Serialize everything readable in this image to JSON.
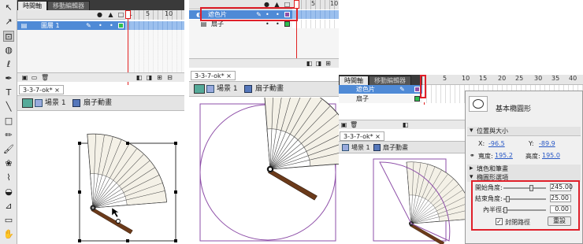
{
  "panel1": {
    "tabs": [
      "時間軸",
      "移動編輯器"
    ],
    "ruler": [
      "1",
      "5",
      "10"
    ],
    "layer": "圖層 1",
    "doc_tab": "3-3-7-ok*",
    "scene": "場景 1",
    "symbol": "扇子動畫"
  },
  "panel2": {
    "ruler": [
      "1",
      "5",
      "10"
    ],
    "layers": [
      "遮色片",
      "扇子"
    ],
    "doc_tab": "3-3-7-ok*",
    "scene": "場景 1",
    "symbol": "扇子動畫"
  },
  "panel3": {
    "tabs": [
      "時間軸",
      "移動編輯器"
    ],
    "ruler": [
      "5",
      "10",
      "15",
      "20",
      "25",
      "30",
      "35",
      "40"
    ],
    "layers": [
      "遮色片",
      "扇子"
    ],
    "doc_tab": "3-3-7-ok*",
    "scene": "場景 1",
    "symbol": "扇子動畫"
  },
  "props": {
    "title": "基本橢圓形",
    "sec_pos": "位置與大小",
    "x_label": "X:",
    "x_val": "-96.5",
    "y_label": "Y:",
    "y_val": "-89.9",
    "w_label": "寬度:",
    "w_val": "195.2",
    "h_label": "高度:",
    "h_val": "195.0",
    "sec_fill": "填色和筆畫",
    "sec_ellipse": "橢圓形選項",
    "start_label": "開始角度:",
    "start_val": "245.00",
    "end_label": "結束角度:",
    "end_val": "25.00",
    "inner_label": "內半徑:",
    "inner_val": "0.00",
    "closed_label": "封閉路徑",
    "reset_label": "重設",
    "start_fraction": 0.68,
    "end_fraction": 0.07,
    "inner_fraction": 0.0
  },
  "colors": {
    "highlight": "#e0202a",
    "selection": "#4f8ad6",
    "mask": "#8e4fa8"
  },
  "icons": [
    "eye-icon",
    "lock-icon",
    "outline-icon",
    "pencil-icon",
    "trash-icon",
    "scene-icon",
    "symbol-icon",
    "close-icon"
  ]
}
